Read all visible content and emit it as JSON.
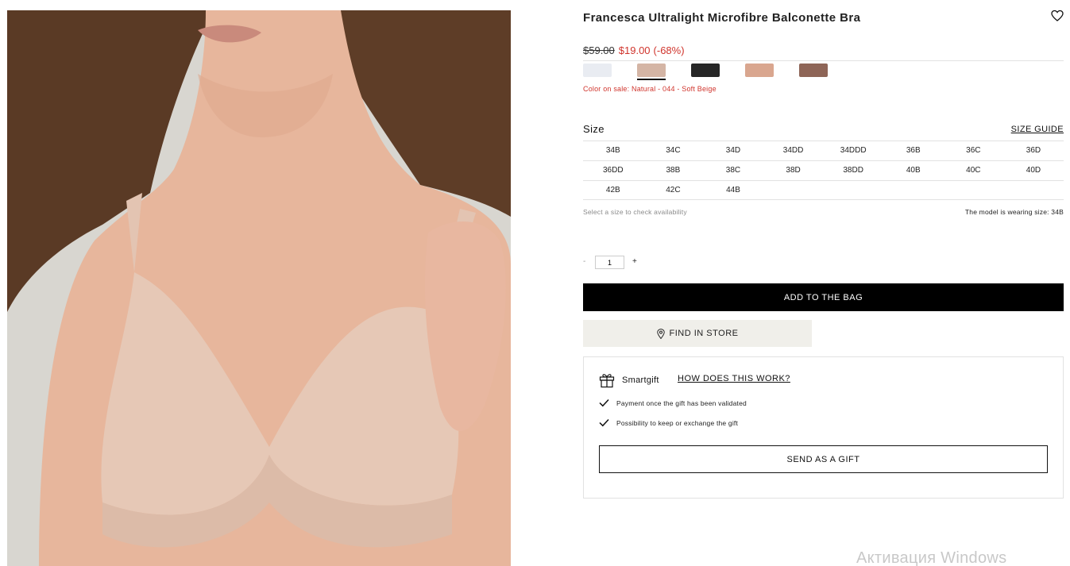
{
  "product": {
    "title": "Francesca Ultralight Microfibre Balconette Bra",
    "image_alt": "Model wearing a soft beige balconette bra",
    "price": {
      "old": "$59.00",
      "new": "$19.00",
      "discount": "(-68%)"
    }
  },
  "colors": {
    "swatches": [
      {
        "name": "white",
        "hex": "#e9ecf2"
      },
      {
        "name": "soft-beige",
        "hex": "#d4b5a5",
        "selected": true
      },
      {
        "name": "black",
        "hex": "#262626"
      },
      {
        "name": "natural",
        "hex": "#d9a68f"
      },
      {
        "name": "mocha",
        "hex": "#8e6557"
      }
    ],
    "color_on_sale": "Color on sale: Natural - 044 - Soft Beige"
  },
  "size": {
    "label": "Size",
    "guide_label": "SIZE GUIDE",
    "rows": [
      [
        "34B",
        "34C",
        "34D",
        "34DD",
        "34DDD",
        "36B",
        "36C",
        "36D"
      ],
      [
        "36DD",
        "38B",
        "38C",
        "38D",
        "38DD",
        "40B",
        "40C",
        "40D"
      ],
      [
        "42B",
        "42C",
        "44B"
      ]
    ],
    "hint": "Select a size to check availability",
    "model_note": "The model is wearing size: 34B"
  },
  "quantity": {
    "minus": "-",
    "value": "1",
    "plus": "+"
  },
  "actions": {
    "add_to_bag": "ADD TO THE BAG",
    "find_in_store": "FIND IN STORE"
  },
  "gift": {
    "title": "Smartgift",
    "how_link": "HOW DOES THIS WORK?",
    "points": [
      "Payment once the gift has been validated",
      "Possibility to keep or exchange the gift"
    ],
    "send_label": "SEND AS A GIFT"
  },
  "os_watermark": "Активация Windows",
  "icons": {
    "wishlist": "heart-icon",
    "store": "location-pin-icon",
    "gift": "gift-icon",
    "check": "check-icon"
  }
}
